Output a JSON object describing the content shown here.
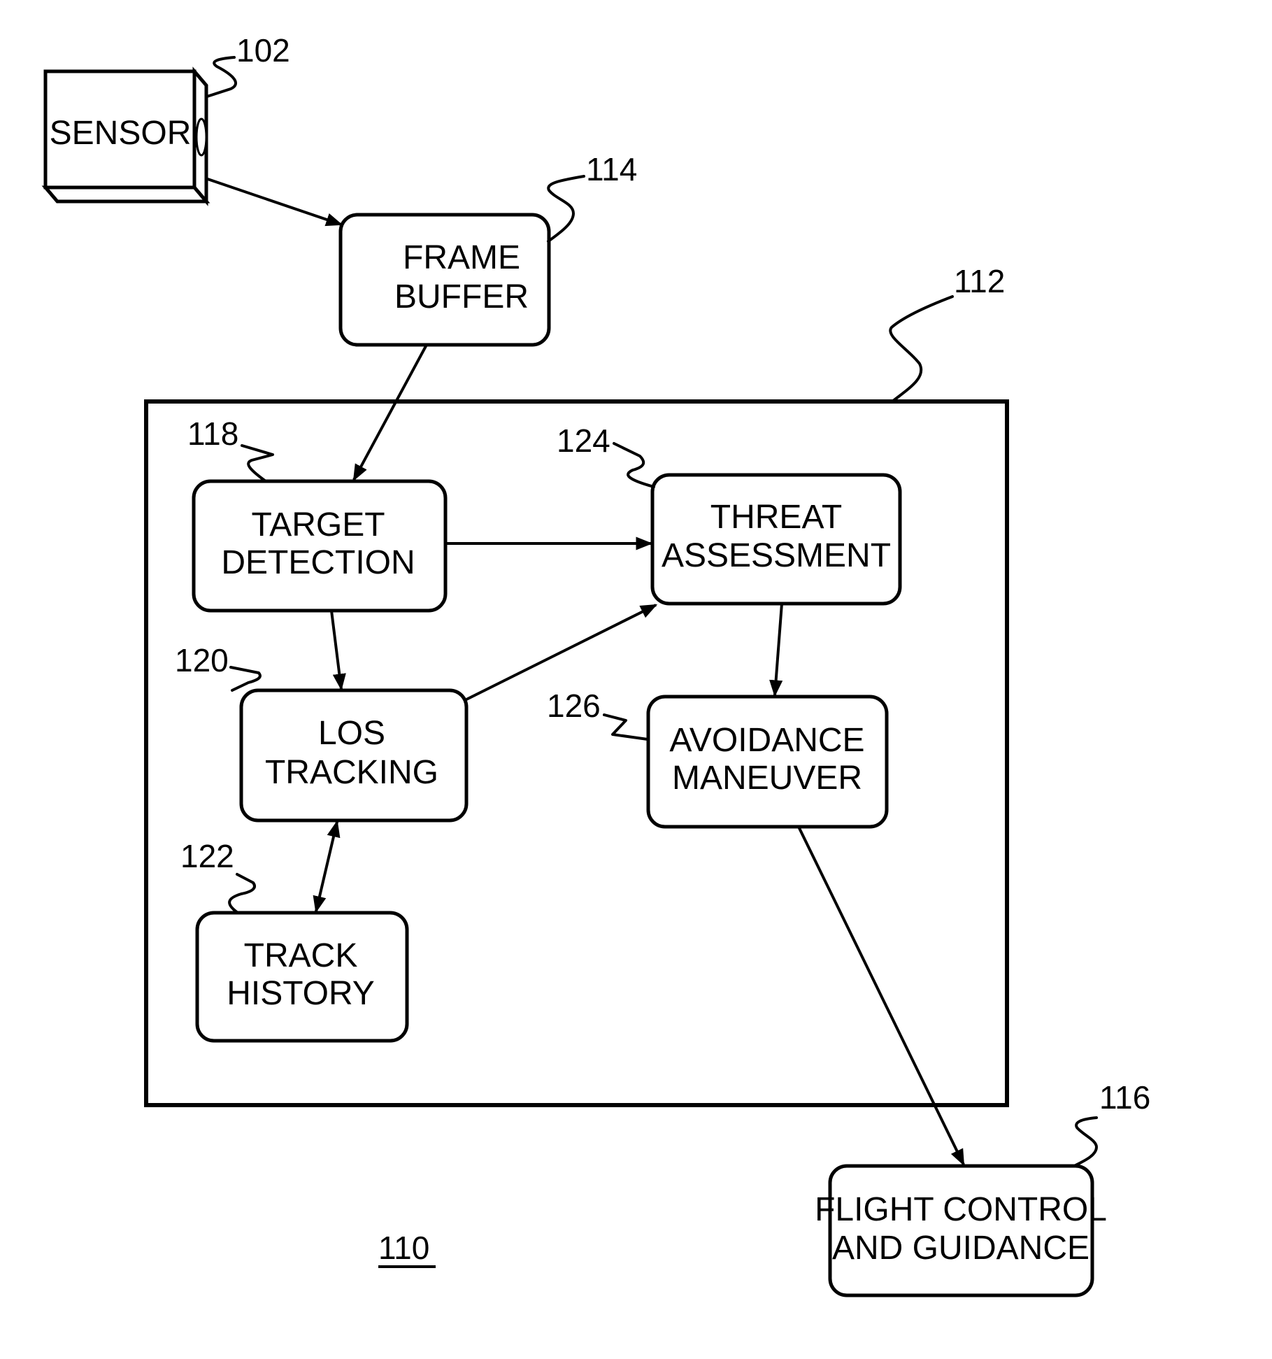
{
  "figure_number": "110",
  "system": {
    "ref": "112"
  },
  "blocks": {
    "sensor": {
      "ref": "102",
      "lines": [
        "SENSOR"
      ]
    },
    "frame_buffer": {
      "ref": "114",
      "lines": [
        "FRAME",
        "BUFFER"
      ]
    },
    "target_detection": {
      "ref": "118",
      "lines": [
        "TARGET",
        "DETECTION"
      ]
    },
    "los_tracking": {
      "ref": "120",
      "lines": [
        "LOS",
        "TRACKING"
      ]
    },
    "track_history": {
      "ref": "122",
      "lines": [
        "TRACK",
        "HISTORY"
      ]
    },
    "threat_assessment": {
      "ref": "124",
      "lines": [
        "THREAT",
        "ASSESSMENT"
      ]
    },
    "avoidance_maneuver": {
      "ref": "126",
      "lines": [
        "AVOIDANCE",
        "MANEUVER"
      ]
    },
    "flight_control": {
      "ref": "116",
      "lines": [
        "FLIGHT CONTROL",
        "AND GUIDANCE"
      ]
    }
  },
  "connections": [
    {
      "from": "sensor",
      "to": "frame_buffer",
      "direction": "forward"
    },
    {
      "from": "frame_buffer",
      "to": "target_detection",
      "direction": "forward"
    },
    {
      "from": "target_detection",
      "to": "threat_assessment",
      "direction": "forward"
    },
    {
      "from": "target_detection",
      "to": "los_tracking",
      "direction": "forward"
    },
    {
      "from": "los_tracking",
      "to": "threat_assessment",
      "direction": "forward"
    },
    {
      "from": "los_tracking",
      "to": "track_history",
      "direction": "bidirectional"
    },
    {
      "from": "threat_assessment",
      "to": "avoidance_maneuver",
      "direction": "forward"
    },
    {
      "from": "avoidance_maneuver",
      "to": "flight_control",
      "direction": "forward"
    }
  ]
}
